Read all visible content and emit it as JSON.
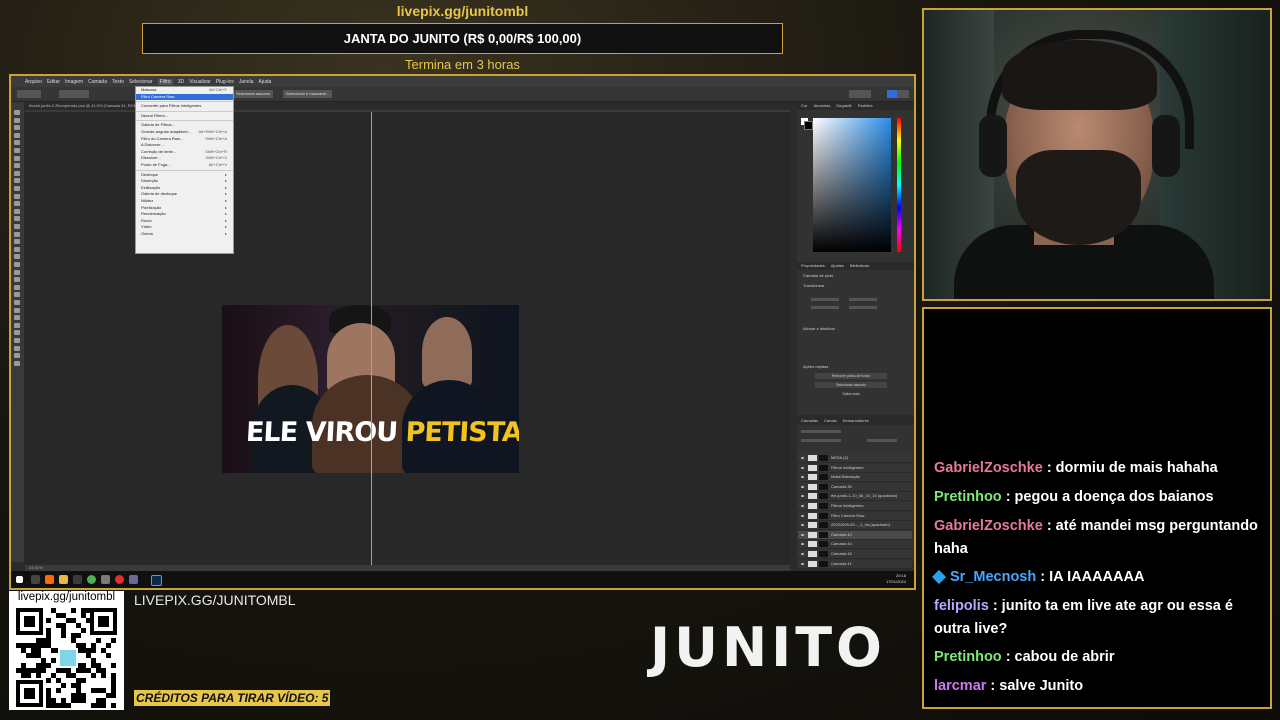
{
  "overlay": {
    "top_url": "livepix.gg/junitombl",
    "goal_title": "JANTA DO JUNITO (R$ 0,00/R$ 100,00)",
    "goal_progress": 0,
    "goal_subtitle": "Termina em 3 horas",
    "lower_url": "LIVEPIX.GG/JUNITOMBL",
    "credits": "CRÉDITOS PARA TIRAR VÍDEO: 5",
    "qr_label": "livepix.gg/junitombl",
    "logo": "JUNITO"
  },
  "photoshop": {
    "menubar": [
      "Arquivo",
      "Editar",
      "Imagem",
      "Camada",
      "Texto",
      "Selecionar",
      "Filtro",
      "3D",
      "Visualizar",
      "Plug-ins",
      "Janela",
      "Ajuda"
    ],
    "options_buttons": [
      "Selecionar assunto",
      "Selecionar e mascarar..."
    ],
    "document_tab": "thumb junito 2-Recuperado.psd @ 41,9% (Camada 41, RGB/8#)",
    "status": "41,91%",
    "thumbnail": {
      "text_white": "ELE VIROU ",
      "text_yellow": "PETISTA"
    },
    "filter_menu": [
      {
        "label": "Máscara",
        "shortcut": "Alt+Ctrl+F",
        "sep_after": false
      },
      {
        "label": "Filtro Camera Raw",
        "shortcut": "",
        "selected": true,
        "sep_after": true
      },
      {
        "label": "Converter para Filtros Inteligentes",
        "shortcut": "",
        "sep_after": true
      },
      {
        "label": "Neural Filters...",
        "shortcut": "",
        "sep_after": true
      },
      {
        "label": "Galeria de Filtros...",
        "shortcut": ""
      },
      {
        "label": "Grande-angular adaptável...",
        "shortcut": "Alt+Shift+Ctrl+A"
      },
      {
        "label": "Filtro do Camera Raw...",
        "shortcut": "Shift+Ctrl+A"
      },
      {
        "label": "A Distorcer...",
        "shortcut": ""
      },
      {
        "label": "Correção de lente...",
        "shortcut": "Shift+Ctrl+R"
      },
      {
        "label": "Dissolver...",
        "shortcut": "Shift+Ctrl+X"
      },
      {
        "label": "Ponto de Fuga...",
        "shortcut": "Alt+Ctrl+V",
        "sep_after": true
      },
      {
        "label": "Desfoque",
        "shortcut": "▸"
      },
      {
        "label": "Distorção",
        "shortcut": "▸"
      },
      {
        "label": "Estilização",
        "shortcut": "▸"
      },
      {
        "label": "Galeria de desfoque",
        "shortcut": "▸"
      },
      {
        "label": "Nitidez",
        "shortcut": "▸"
      },
      {
        "label": "Pixelização",
        "shortcut": "▸"
      },
      {
        "label": "Renderização",
        "shortcut": "▸"
      },
      {
        "label": "Ruído",
        "shortcut": "▸"
      },
      {
        "label": "Vídeo",
        "shortcut": "▸"
      },
      {
        "label": "Outros",
        "shortcut": "▸"
      }
    ],
    "panels": {
      "color_tabs": [
        "Cor",
        "Amostras",
        "Degradê",
        "Padrões"
      ],
      "properties_tabs": [
        "Propriedades",
        "Ajustes",
        "Bibliotecas"
      ],
      "properties_title": "Camada de pixel",
      "transform_label": "Transformar",
      "align_label": "Alinhar e distribuir",
      "quick_actions_label": "Ações rápidas",
      "qa_buttons": [
        "Remover plano de fundo",
        "Selecionar assunto",
        "Saiba mais"
      ],
      "layers_tabs": [
        "Camadas",
        "Canais",
        "Demarcadores"
      ],
      "layers": [
        {
          "name": "MESA (2)"
        },
        {
          "name": "Filtros Inteligentes"
        },
        {
          "name": "Matiz/Saturação"
        },
        {
          "name": "Camada 36"
        },
        {
          "name": "ele-junito-1-10_06_03_15 (quadrado)"
        },
        {
          "name": "Filtros Inteligentes"
        },
        {
          "name": "Filtro Camera Raw"
        },
        {
          "name": "20231009-05..._3_hd-(quadrado)"
        },
        {
          "name": "Camada 40"
        },
        {
          "name": "Camada 44"
        },
        {
          "name": "Camada 45"
        },
        {
          "name": "Camada 41"
        }
      ]
    },
    "clock": {
      "time": "20:18",
      "date": "17/01/2024"
    }
  },
  "chat": [
    {
      "user": "GabrielZoschke",
      "color": "#e67a96",
      "text": ": dormiu de mais hahaha",
      "badge": false
    },
    {
      "user": "Pretinhoo",
      "color": "#7de87a",
      "text": ": pegou a doença dos baianos",
      "badge": false
    },
    {
      "user": "GabrielZoschke",
      "color": "#e67a96",
      "text": ": até mandei msg perguntando haha",
      "badge": false
    },
    {
      "user": "Sr_Mecnosh",
      "color": "#4aa6ff",
      "text": ": IA IAAAAAAA",
      "badge": true
    },
    {
      "user": "felipolis",
      "color": "#b7a7ff",
      "text": ": junito ta em live ate agr ou essa é outra live?",
      "badge": false
    },
    {
      "user": "Pretinhoo",
      "color": "#7de87a",
      "text": ": cabou de abrir",
      "badge": false
    },
    {
      "user": "larcmar",
      "color": "#c97af0",
      "text": ": salve Junito",
      "badge": false
    }
  ],
  "colors": {
    "accent": "#c9a33a",
    "gold_text": "#e8c64a",
    "ps_blue": "#2e6fd8"
  }
}
